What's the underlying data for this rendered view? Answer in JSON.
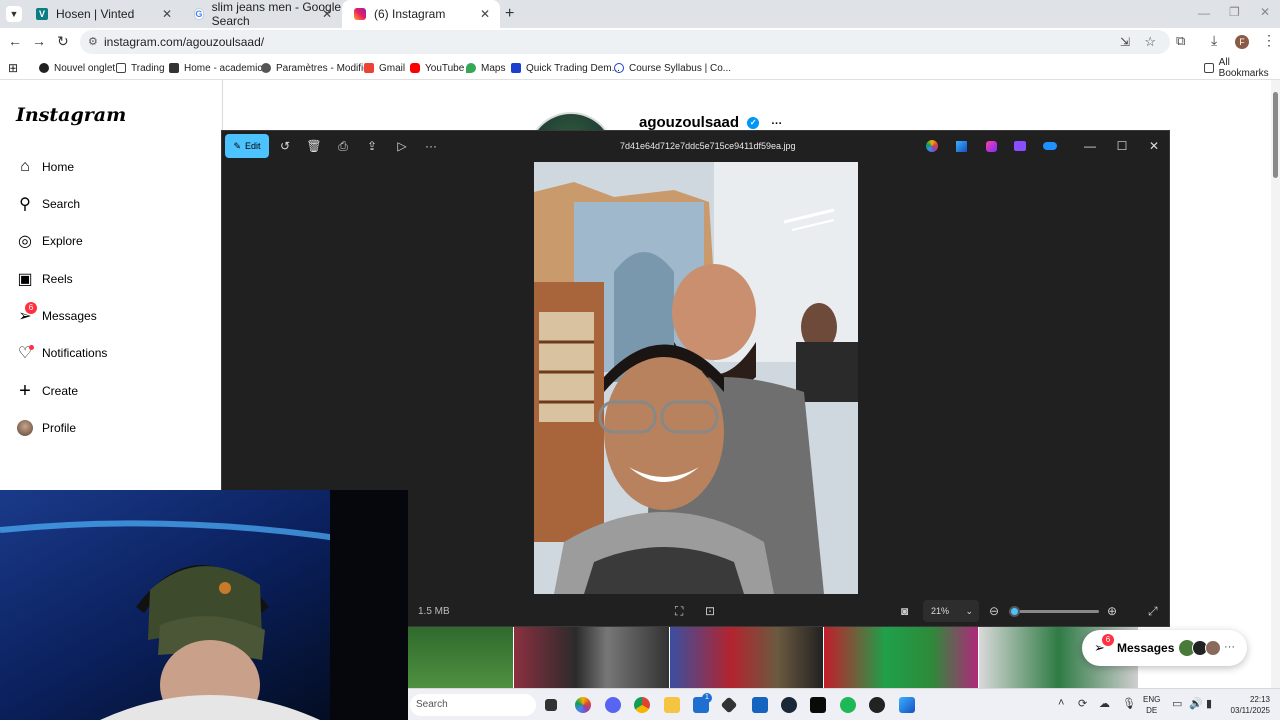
{
  "browser": {
    "tabs": [
      {
        "title": "Hosen | Vinted",
        "active": false
      },
      {
        "title": "slim jeans men - Google Search",
        "active": false
      },
      {
        "title": "(6) Instagram",
        "active": true
      }
    ],
    "url": "instagram.com/agouzoulsaad/",
    "bookmarks": [
      "Nouvel onglet",
      "Trading",
      "Home - academics",
      "Paramètres - Modifier",
      "Gmail",
      "YouTube",
      "Maps",
      "Quick Trading Dem...",
      "Course Syllabus | Co..."
    ],
    "all_bookmarks": "All Bookmarks",
    "profile_initial": "F"
  },
  "instagram": {
    "logo": "Instagram",
    "nav": [
      {
        "label": "Home",
        "icon": "home-icon"
      },
      {
        "label": "Search",
        "icon": "search-icon"
      },
      {
        "label": "Explore",
        "icon": "compass-icon"
      },
      {
        "label": "Reels",
        "icon": "reels-icon"
      },
      {
        "label": "Messages",
        "icon": "messenger-icon",
        "badge": "6"
      },
      {
        "label": "Notifications",
        "icon": "heart-icon"
      },
      {
        "label": "Create",
        "icon": "plus-icon"
      },
      {
        "label": "Profile",
        "icon": "avatar"
      }
    ],
    "profile_username": "agouzoulsaad",
    "more": "···",
    "messages_pill": {
      "label": "Messages",
      "badge": "6",
      "more": "···"
    }
  },
  "viewer": {
    "edit_label": "Edit",
    "filename": "7d41e64d712e7ddc5e715ce9411df59ea.jpg",
    "file_size": "1.5 MB",
    "zoom": "21%",
    "zoom_level": 0.05
  },
  "taskbar": {
    "search_placeholder": "Search",
    "lang_top": "ENG",
    "lang_bottom": "DE",
    "time": "22:13",
    "date": "03/11/2025",
    "badge_steam": "1"
  },
  "colors": {
    "accent": "#4cc2ff",
    "instagram_badge": "#ff3040",
    "verified": "#0095f6"
  }
}
